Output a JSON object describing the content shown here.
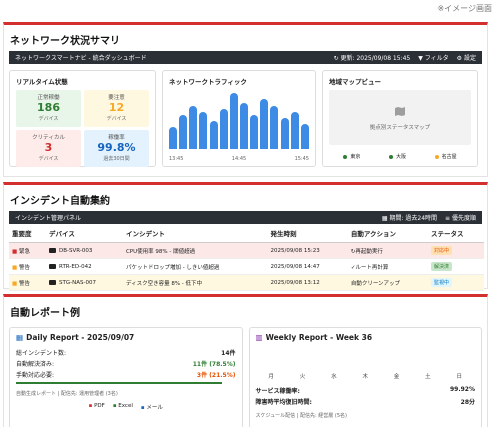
{
  "corner_note": "※イメージ画面",
  "summary": {
    "title": "ネットワーク状況サマリ",
    "bar_title": "ネットワークスマートナビ - 統合ダッシュボード",
    "bar_updated": "更新: 2025/09/08 15:45",
    "bar_filter": "フィルタ",
    "bar_settings": "設定",
    "realtime": {
      "title": "リアルタイム状態",
      "normal": {
        "label": "正常稼働",
        "value": "186",
        "unit": "デバイス"
      },
      "warning": {
        "label": "要注意",
        "value": "12",
        "unit": "デバイス"
      },
      "critical": {
        "label": "クリティカル",
        "value": "3",
        "unit": "デバイス"
      },
      "uptime": {
        "label": "稼働率",
        "value": "99.8%",
        "unit": "過去30日間"
      }
    },
    "traffic": {
      "title": "ネットワークトラフィック",
      "t_start": "13:45",
      "t_mid": "14:45",
      "t_end": "15:45",
      "bar_levels": [
        0.35,
        0.55,
        0.7,
        0.6,
        0.45,
        0.65,
        0.9,
        0.75,
        0.55,
        0.8,
        0.7,
        0.5,
        0.6,
        0.4
      ]
    },
    "map": {
      "title": "地域マップビュー",
      "placeholder": "拠点別ステータスマップ",
      "cities": [
        {
          "name": "東京",
          "color": "#2e7d32"
        },
        {
          "name": "大阪",
          "color": "#2e7d32"
        },
        {
          "name": "名古屋",
          "color": "#f9a825"
        }
      ]
    }
  },
  "incidents": {
    "title": "インシデント自動集約",
    "bar_title": "インシデント管理パネル",
    "bar_period": "期間: 過去24時間",
    "bar_sort": "優先度順",
    "headers": [
      "重要度",
      "デバイス",
      "インシデント",
      "発生時刻",
      "自動アクション",
      "ステータス"
    ],
    "rows": [
      {
        "severity": "緊急",
        "device": "DB-SVR-003",
        "incident": "CPU使用率 98% - 閾値超過",
        "time": "2025/09/08 15:23",
        "action": "↻再起動実行",
        "status": "対応中",
        "bg": "#fde8e8",
        "icon_color": "#d32f2f",
        "badge_bg": "#ffe0b2",
        "badge_fg": "#e65100"
      },
      {
        "severity": "警告",
        "device": "RTR-ED-042",
        "incident": "パケットドロップ増加 - しきい値超過",
        "time": "2025/09/08 14:47",
        "action": "✓ルート再計算",
        "status": "解決済",
        "bg": "#ffffff",
        "icon_color": "#f9a825",
        "badge_bg": "#c8e6c9",
        "badge_fg": "#2e7d32"
      },
      {
        "severity": "警告",
        "device": "STG-NAS-007",
        "incident": "ディスク空き容量 8% - 低下中",
        "time": "2025/09/08 13:12",
        "action": "自動クリーンアップ",
        "status": "監視中",
        "bg": "#fff8e1",
        "icon_color": "#f9a825",
        "badge_bg": "#e1f5fe",
        "badge_fg": "#0277bd"
      }
    ]
  },
  "reports": {
    "title": "自動レポート例",
    "daily": {
      "title": "Daily Report - 2025/09/07",
      "rows": [
        {
          "label": "総インシデント数:",
          "value": "14件",
          "color": "#222"
        },
        {
          "label": "自動解決済み:",
          "value": "11件 (78.5%)",
          "color": "#2e7d32"
        },
        {
          "label": "手動対応必要:",
          "value": "3件 (21.5%)",
          "color": "#e65100"
        }
      ],
      "meta": "自動生成レポート | 配信先: 運用管理者 (3名)",
      "exports": [
        "PDF",
        "Excel",
        "メール"
      ]
    },
    "weekly": {
      "title": "Weekly Report - Week 36",
      "days": [
        "月",
        "火",
        "水",
        "木",
        "金",
        "土",
        "日"
      ],
      "rows": [
        {
          "label": "サービス稼働率:",
          "value": "99.92%"
        },
        {
          "label": "障害時平均復旧時間:",
          "value": "28分"
        }
      ],
      "meta": "スケジュール配信 | 配信先: 経営層 (5名)"
    }
  }
}
